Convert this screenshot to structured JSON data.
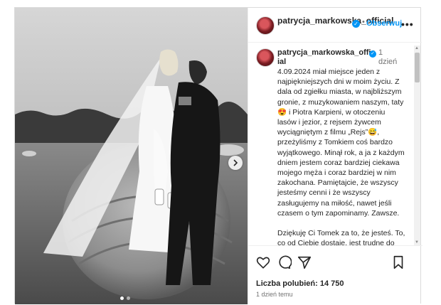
{
  "post": {
    "image_alt": "Black and white wedding photo",
    "carousel": {
      "slide_count": 2,
      "active_index": 0
    }
  },
  "header": {
    "username": "patrycja_markowska_official",
    "follow_label": "Obserwuj",
    "bullet": "•",
    "more": "•••"
  },
  "caption": {
    "username": "patrycja_markowska_official",
    "time": "1 dzień",
    "text": "4.09.2024 miał miejsce jeden z najpiękniejszych dni w moim życiu. Z dala od zgiełku miasta, w najbliższym gronie, z muzykowaniem naszym, taty 😍 i Piotra Karpieni, w otoczeniu lasów i jezior, z rejsem żywcem wyciągniętym z filmu „Rejs”😅, przeżyliśmy z Tomkiem coś bardzo wyjątkowego. Minął rok, a ja z każdym dniem jestem coraz bardziej ciekawa mojego męża i coraz bardziej w nim  zakochana. Pamiętajcie, że wszyscy jesteśmy cenni i że wszyscy zasługujemy na miłość, nawet jeśli czasem o tym zapominamy. Zawsze.\n\nDziękuję Ci Tomek za to, że jesteś. To, co od Ciebie dostaję, jest trudne do opisania słowami, jest to m.in. wielkie wsparcie na każdej płaszczyźnie i"
  },
  "actions": {
    "likes": "Liczba polubień: 14 750",
    "posted": "1 dzień temu"
  },
  "colors": {
    "accent": "#0095f6",
    "text": "#262626",
    "muted": "#737373"
  }
}
